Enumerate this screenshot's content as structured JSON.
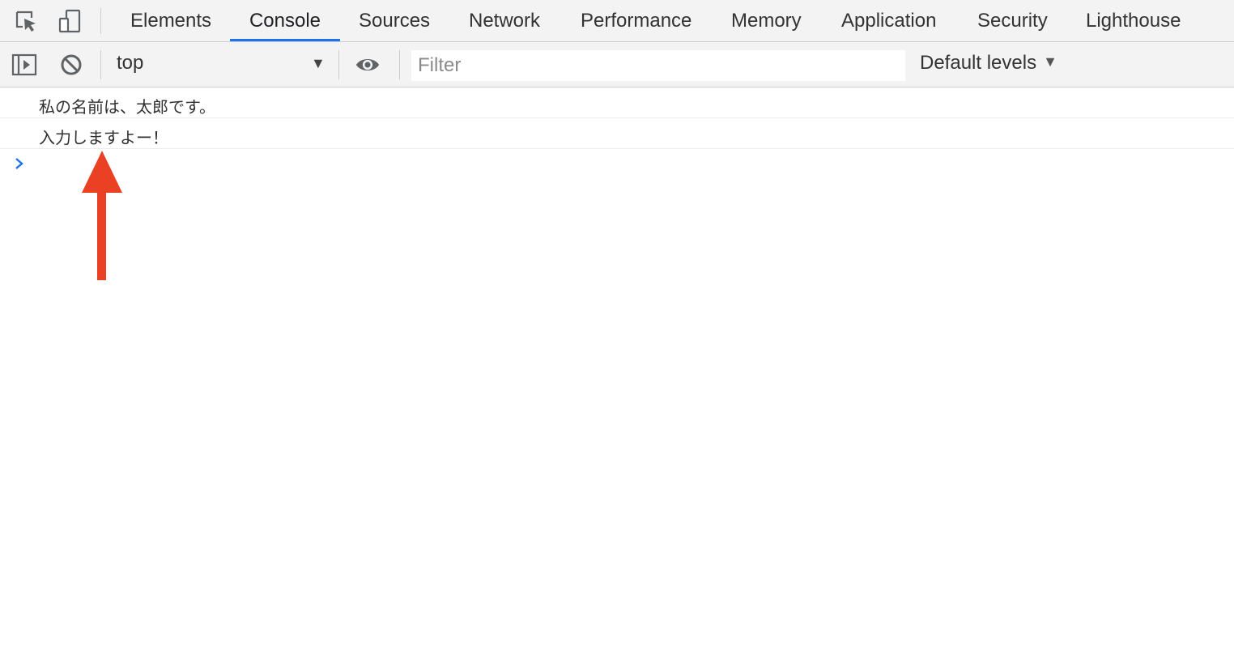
{
  "tabs": [
    {
      "label": "Elements"
    },
    {
      "label": "Console"
    },
    {
      "label": "Sources"
    },
    {
      "label": "Network"
    },
    {
      "label": "Performance"
    },
    {
      "label": "Memory"
    },
    {
      "label": "Application"
    },
    {
      "label": "Security"
    },
    {
      "label": "Lighthouse"
    }
  ],
  "active_tab": "Console",
  "toolbar": {
    "context": "top",
    "filter_placeholder": "Filter",
    "levels_label": "Default levels"
  },
  "console": {
    "messages": [
      {
        "text": "私の名前は、太郎です。"
      },
      {
        "text": "入力しますよー！"
      }
    ]
  },
  "icons": {
    "inspect": "inspect-element-icon",
    "device": "device-toolbar-icon",
    "sidebar": "show-sidebar-icon",
    "clear": "clear-console-icon",
    "eye": "live-expression-eye-icon",
    "prompt": "chevron-right-icon",
    "annotation": "red-up-arrow"
  },
  "colors": {
    "accent": "#1a73e8",
    "annotation": "#ea4125",
    "toolbar_bg": "#f3f3f3"
  }
}
